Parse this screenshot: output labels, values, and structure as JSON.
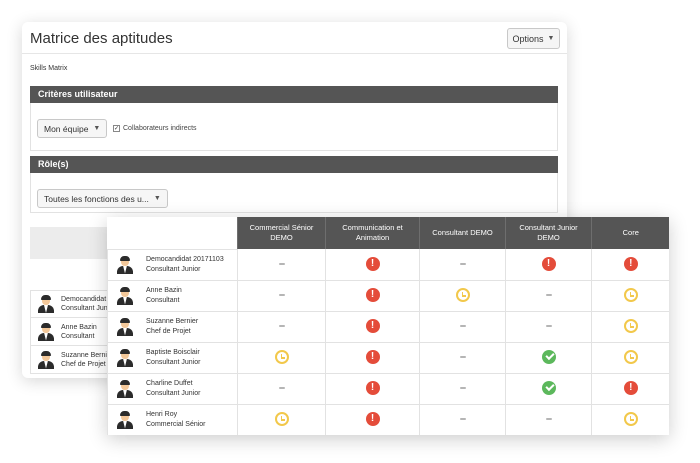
{
  "header": {
    "title": "Matrice des aptitudes",
    "options_label": "Options"
  },
  "subtitle": "Skills Matrix",
  "user_criteria": {
    "title": "Critères utilisateur",
    "team_select": "Mon équipe",
    "indirect_checkbox_label": "Collaborateurs indirects",
    "indirect_checked": true
  },
  "roles": {
    "title": "Rôle(s)",
    "select_value": "Toutes les fonctions des u..."
  },
  "back_rows": [
    {
      "name": "Democandidat",
      "role": "Consultant Jun"
    },
    {
      "name": "Anne Bazin",
      "role": "Consultant"
    },
    {
      "name": "Suzanne Berni",
      "role": "Chef de Projet"
    }
  ],
  "matrix": {
    "columns": [
      "Commercial Sénior DEMO",
      "Communication et Animation",
      "Consultant DEMO",
      "Consultant Junior DEMO",
      "Core"
    ],
    "rows": [
      {
        "name": "Democandidat 20171103",
        "role": "Consultant Junior",
        "status": [
          "dash",
          "alert",
          "dash",
          "alert",
          "alert"
        ]
      },
      {
        "name": "Anne Bazin",
        "role": "Consultant",
        "status": [
          "dash",
          "alert",
          "clock",
          "dash",
          "clock"
        ]
      },
      {
        "name": "Suzanne Bernier",
        "role": "Chef de Projet",
        "status": [
          "dash",
          "alert",
          "dash",
          "dash",
          "clock"
        ]
      },
      {
        "name": "Baptiste Boisclair",
        "role": "Consultant Junior",
        "status": [
          "clock",
          "alert",
          "dash",
          "check",
          "clock"
        ]
      },
      {
        "name": "Charline Duffet",
        "role": "Consultant Junior",
        "status": [
          "dash",
          "alert",
          "dash",
          "check",
          "alert"
        ]
      },
      {
        "name": "Henri Roy",
        "role": "Commercial Sénior",
        "status": [
          "clock",
          "alert",
          "dash",
          "dash",
          "clock"
        ]
      }
    ]
  },
  "icons": {
    "dash": "not-applicable-icon",
    "alert": "exclamation-icon",
    "clock": "pending-clock-icon",
    "check": "check-icon"
  },
  "colors": {
    "header_bar": "#555555",
    "alert": "#e44c3a",
    "pending": "#f2c84b",
    "ok": "#5cb85c"
  }
}
